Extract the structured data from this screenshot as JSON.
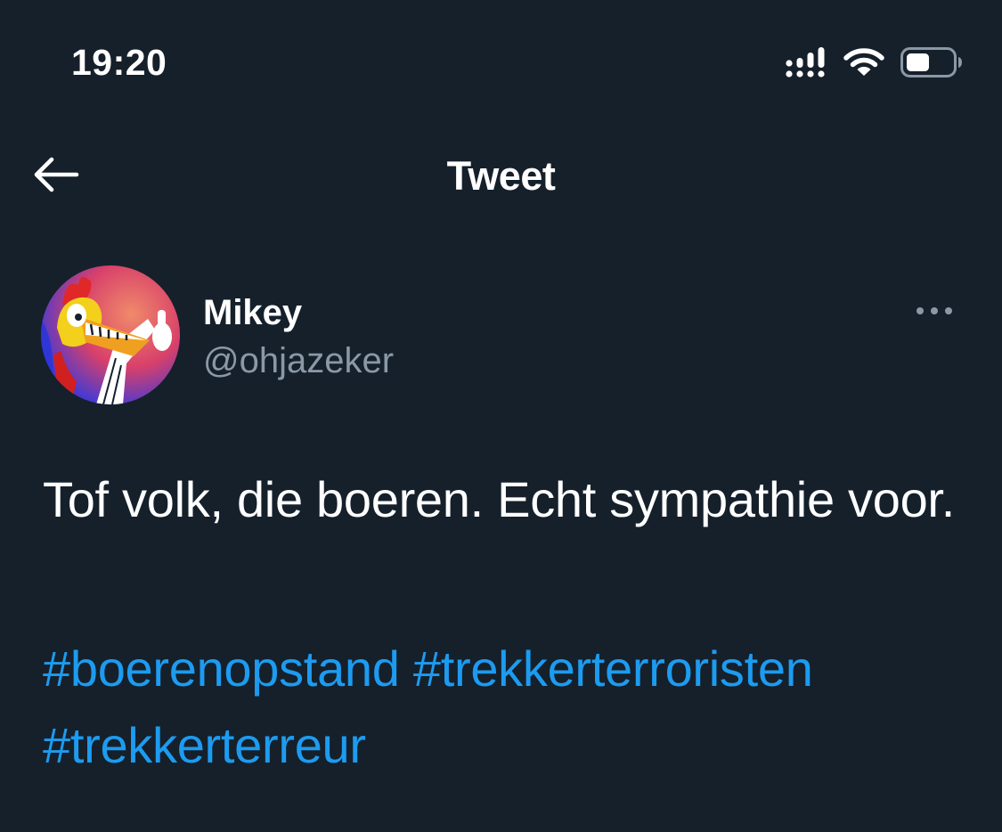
{
  "status_bar": {
    "time": "19:20",
    "icons": [
      "cellular-signal-icon",
      "wifi-icon",
      "battery-icon"
    ]
  },
  "header": {
    "back_icon": "arrow-left-icon",
    "title": "Tweet"
  },
  "tweet": {
    "author": {
      "name": "Mikey",
      "handle": "@ohjazeker"
    },
    "more_icon": "more-horizontal-icon",
    "text": "Tof volk, die boeren. Echt sympathie voor.",
    "hashtags": [
      "#boerenopstand",
      "#trekkerterroristen",
      "#trekkerterreur"
    ]
  },
  "colors": {
    "background": "#15202b",
    "text": "#ffffff",
    "secondary_text": "#8b98a5",
    "link": "#1d9bf0"
  }
}
